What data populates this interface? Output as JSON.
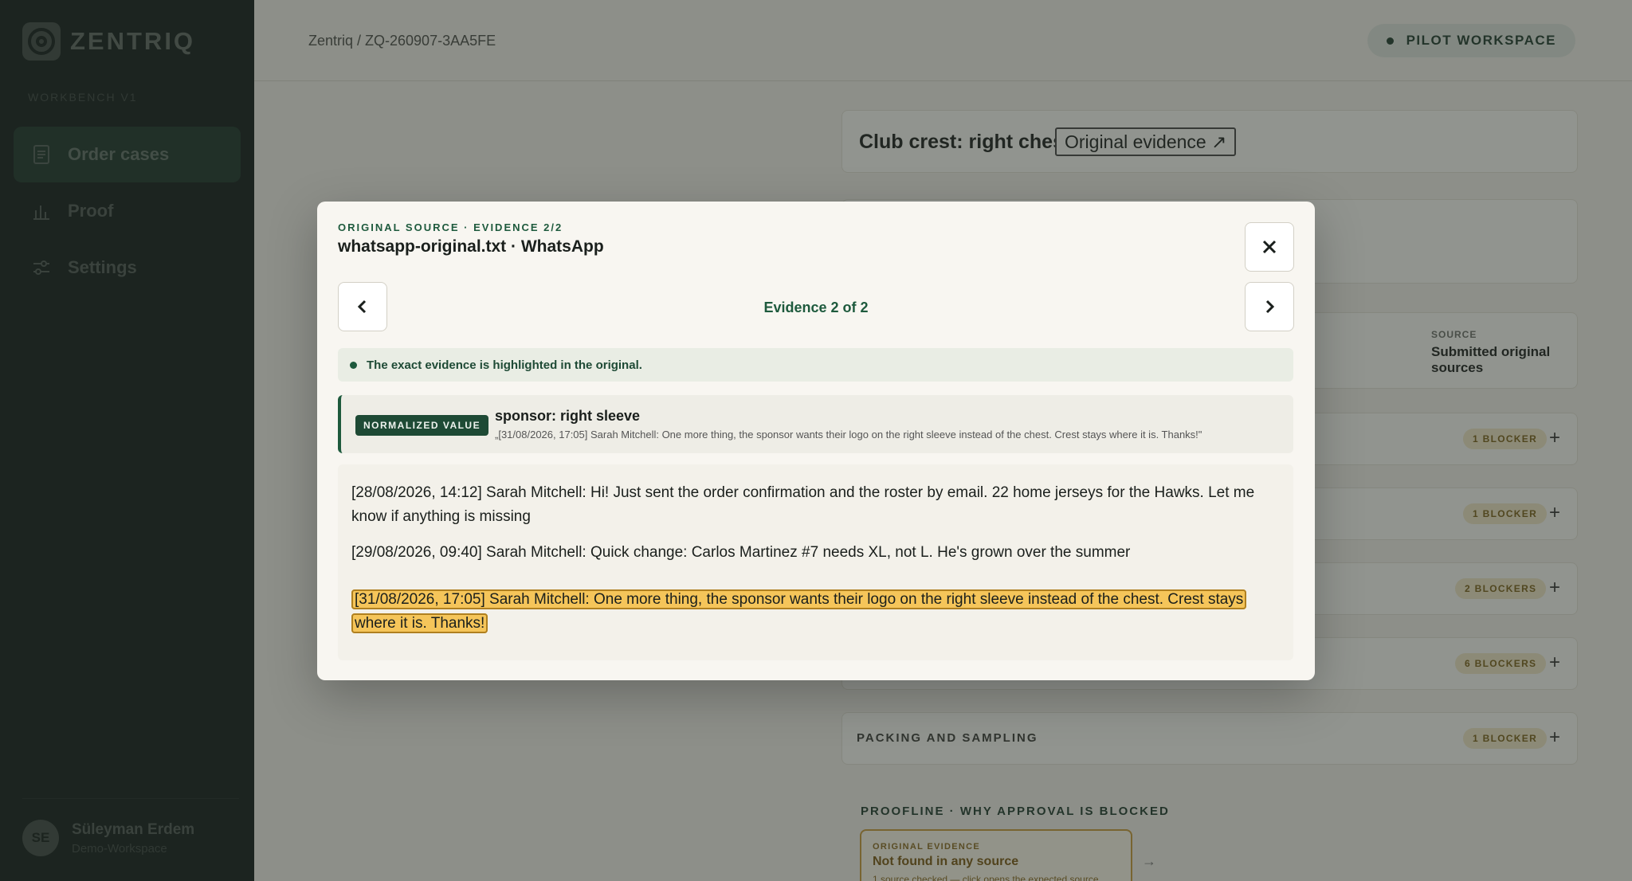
{
  "app": {
    "brand": "ZENTRIQ",
    "workbench": "WORKBENCH V1"
  },
  "sidebar": {
    "items": [
      {
        "label": "Order cases",
        "icon": "document-icon",
        "active": true
      },
      {
        "label": "Proof",
        "icon": "bar-chart-icon",
        "active": false
      },
      {
        "label": "Settings",
        "icon": "sliders-icon",
        "active": false
      }
    ]
  },
  "user": {
    "initials": "SE",
    "name": "Süleyman Erdem",
    "workspace": "Demo-Workspace"
  },
  "header": {
    "breadcrumb": "Zentriq / ZQ-260907-3AA5FE",
    "workspace_pill": "PILOT WORKSPACE"
  },
  "background": {
    "crest_title": "Club crest: right chest",
    "original_evidence_button": "Original evidence ↗",
    "source_label": "SOURCE",
    "source_value": "Submitted original sources",
    "blockers": [
      "1 BLOCKER",
      "1 BLOCKER",
      "2 BLOCKERS",
      "6 BLOCKERS",
      "1 BLOCKER"
    ],
    "packing_title": "PACKING AND SAMPLING",
    "proofline_title": "PROOFLINE · WHY APPROVAL IS BLOCKED",
    "proof_card": {
      "label": "ORIGINAL EVIDENCE",
      "title": "Not found in any source",
      "subtitle": "1 source checked — click opens the expected source"
    }
  },
  "modal": {
    "eyebrow": "ORIGINAL SOURCE · EVIDENCE 2/2",
    "title": "whatsapp-original.txt · WhatsApp",
    "counter": "Evidence 2 of 2",
    "hint": "The exact evidence is highlighted in the original.",
    "normalized": {
      "badge": "NORMALIZED VALUE",
      "value": "sponsor: right sleeve",
      "quote": "„[31/08/2026, 17:05] Sarah Mitchell: One more thing, the sponsor wants their logo on the right sleeve instead of the chest. Crest stays where it is. Thanks!\""
    },
    "messages": [
      "[28/08/2026, 14:12] Sarah Mitchell: Hi! Just sent the order confirmation and the roster by email. 22 home jerseys for the Hawks. Let me know if anything is missing",
      "[29/08/2026, 09:40] Sarah Mitchell: Quick change: Carlos Martinez #7 needs XL, not L. He's grown over the summer",
      "[31/08/2026, 17:05] Sarah Mitchell: One more thing, the sponsor wants their logo on the right sleeve instead of the chest. Crest stays where it is. Thanks!"
    ],
    "highlight_color": "#f5c55a"
  }
}
